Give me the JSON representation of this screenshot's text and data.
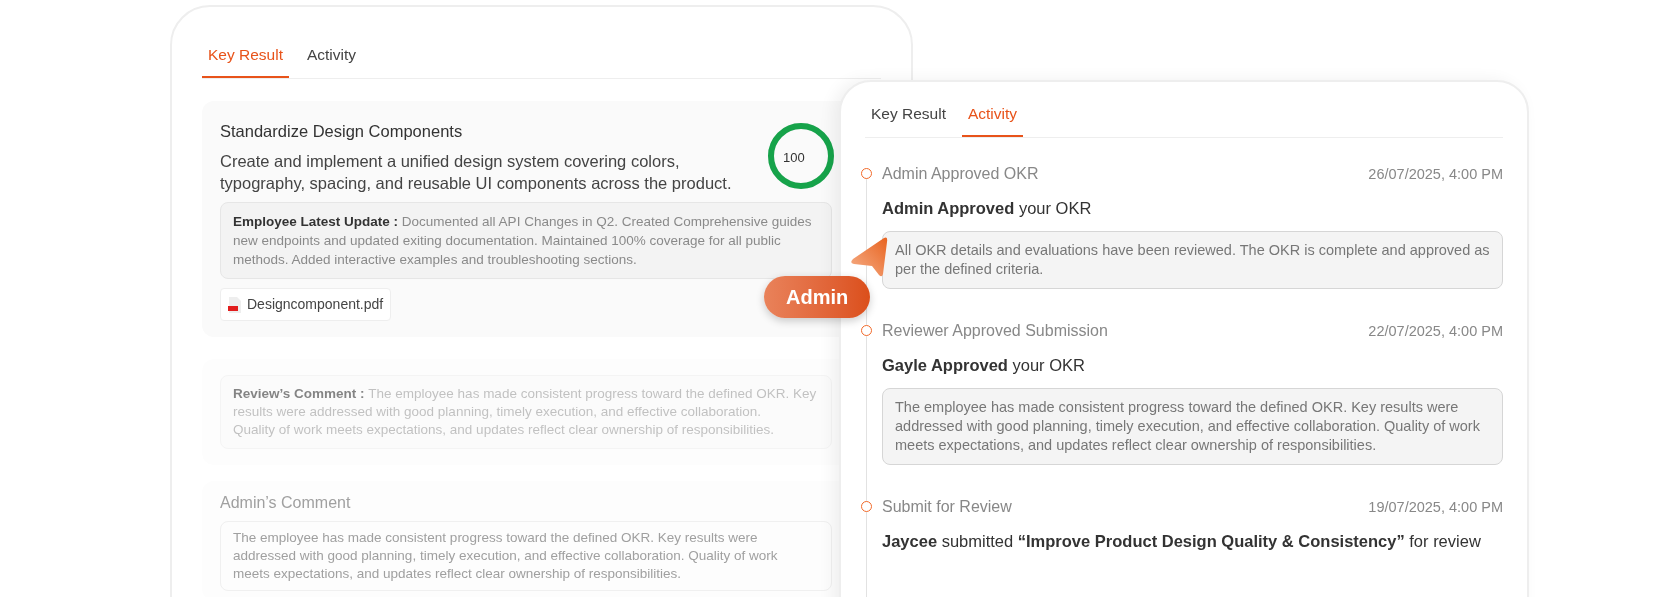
{
  "left_card": {
    "tabs": [
      {
        "label": "Key Result",
        "selected": true
      },
      {
        "label": "Activity",
        "selected": false
      }
    ],
    "key_result": {
      "title": "Standardize Design Components",
      "description": "Create and implement a unified design system covering colors, typography, spacing, and reusable UI components across the product.",
      "progress": {
        "label": "100",
        "level": 1
      },
      "update": {
        "label": "Employee Latest Update :",
        "lines": [
          "Documented all API Changes in Q2. Created Comprehensive guides",
          "new endpoints and updated exiting documentation. Maintained 100% coverage for all public",
          "methods. Added interactive examples and troubleshooting sections."
        ]
      },
      "attachment": {
        "name": "Designcomponent.pdf"
      }
    },
    "review_comment": {
      "label": "Review’s Comment :",
      "lines": [
        "The employee has made consistent progress toward the defined OKR. Key",
        "results were addressed with good planning, timely execution, and effective collaboration.",
        "Quality of work meets expectations, and updates reflect clear ownership of responsibilities."
      ]
    },
    "admin_comment": {
      "title": "Admin’s Comment",
      "lines": [
        "The employee has made consistent progress toward the defined OKR. Key results were",
        "addressed with good planning, timely execution, and effective collaboration. Quality of work",
        "meets expectations, and updates reflect clear ownership of responsibilities."
      ]
    }
  },
  "right_card": {
    "tabs": [
      {
        "label": "Key Result",
        "selected": false
      },
      {
        "label": "Activity",
        "selected": true
      }
    ],
    "activity": [
      {
        "title": "Admin Approved OKR",
        "date": "26/07/2025, 4:00 PM",
        "message": "**Admin Approved** your OKR",
        "comment": "All OKR details and evaluations have been reviewed. The OKR is complete and approved as per the defined criteria."
      },
      {
        "title": "Reviewer Approved Submission",
        "date": "22/07/2025, 4:00 PM",
        "message": "**Gayle Approved** your OKR",
        "comment": "The employee has made consistent progress toward the defined OKR. Key results were addressed with good planning, timely execution, and effective collaboration. Quality of work meets expectations, and updates reflect clear ownership of responsibilities."
      },
      {
        "title": "Submit for Review",
        "date": "19/07/2025, 4:00 PM",
        "message": "**Jaycee** submitted **“Improve Product Design Quality & Consistency”** for review"
      }
    ]
  },
  "cursor": {
    "label": "Admin"
  }
}
